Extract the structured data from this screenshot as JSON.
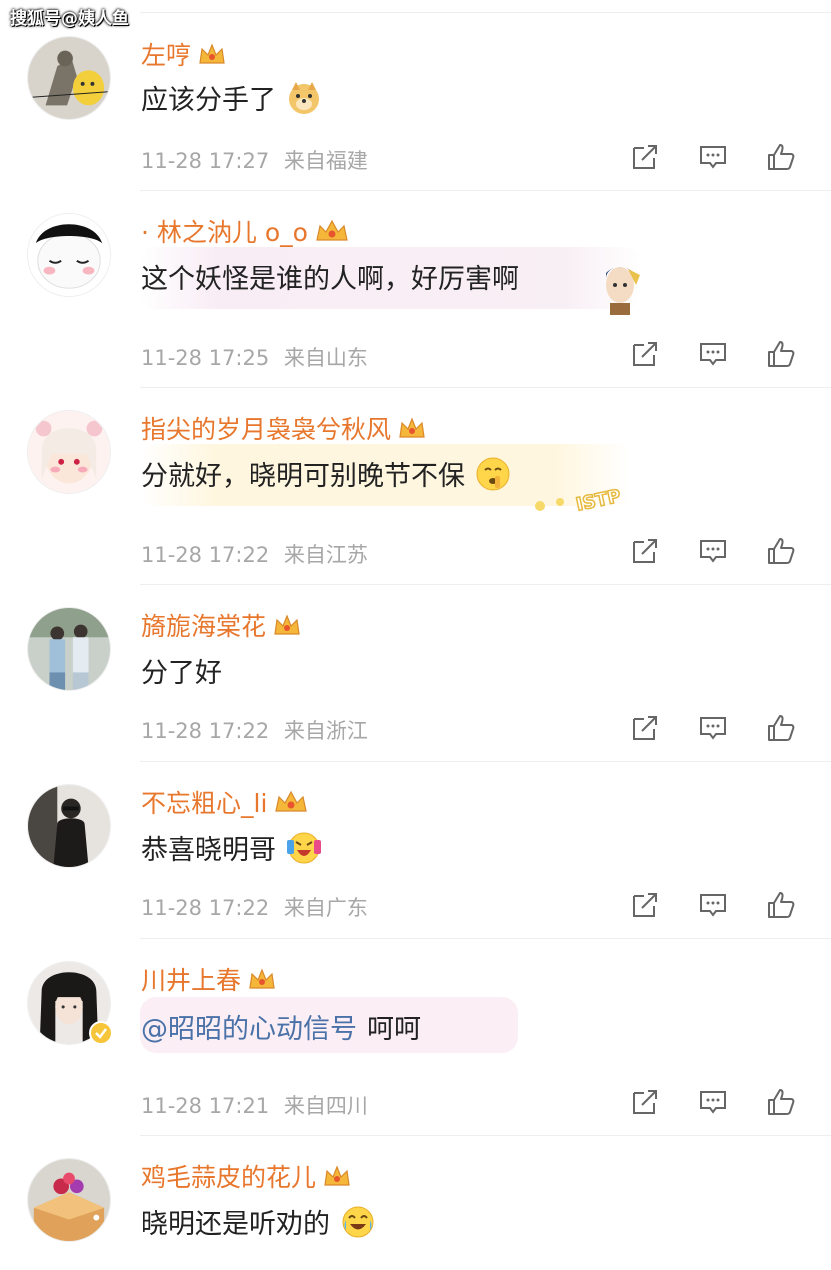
{
  "watermark": "搜狐号@姨人鱼",
  "comments": [
    {
      "user": "左哼",
      "text": "应该分手了",
      "time": "11-28 17:27",
      "location": "来自福建"
    },
    {
      "user": "· 林之汭儿 o_o",
      "text": "这个妖怪是谁的人啊，好厉害啊",
      "time": "11-28 17:25",
      "location": "来自山东"
    },
    {
      "user": "指尖的岁月袅袅兮秋风",
      "text": "分就好，晓明可别晚节不保",
      "time": "11-28 17:22",
      "location": "来自江苏",
      "sticker_text": "ISTP"
    },
    {
      "user": "旖旎海棠花",
      "text": "分了好",
      "time": "11-28 17:22",
      "location": "来自浙江"
    },
    {
      "user": "不忘粗心_li",
      "text": "恭喜晓明哥",
      "time": "11-28 17:22",
      "location": "来自广东"
    },
    {
      "user": "川井上春",
      "mention": "@昭昭的心动信号",
      "text": "呵呵",
      "time": "11-28 17:21",
      "location": "来自四川"
    },
    {
      "user": "鸡毛蒜皮的花儿",
      "text": "晓明还是听劝的",
      "time": "",
      "location": ""
    }
  ],
  "icons": {
    "share": "share-icon",
    "comment": "comment-icon",
    "like": "like-icon",
    "crown": "crown-badge-icon",
    "verified": "verified-badge-icon"
  },
  "colors": {
    "username": "#e8772e",
    "mention": "#4a72a8",
    "meta": "#a7a7a7",
    "text": "#222222"
  }
}
